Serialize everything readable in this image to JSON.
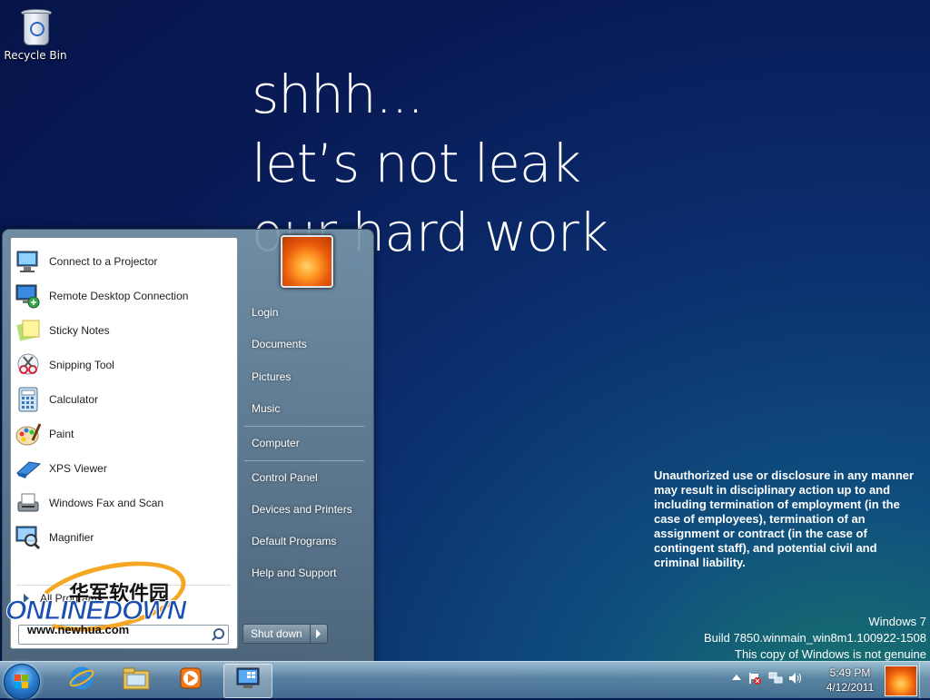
{
  "desktop": {
    "recycle_bin_label": "Recycle Bin",
    "wallpaper_lines": [
      "shhh...",
      "let’s not leak",
      "our hard work"
    ],
    "warning": "Unauthorized use or disclosure in any manner may result in disciplinary action up to and including termination of employment (in the case of employees), termination of an assignment or contract (in the case of contingent staff), and potential civil and criminal liability.",
    "watermark": {
      "line1": "Windows 7",
      "line2": "Build 7850.winmain_win8m1.100922-1508",
      "line3": "This copy of Windows is not genuine"
    }
  },
  "start_menu": {
    "programs": [
      {
        "label": "Connect to a Projector",
        "icon": "projector-icon"
      },
      {
        "label": "Remote Desktop Connection",
        "icon": "remote-desktop-icon"
      },
      {
        "label": "Sticky Notes",
        "icon": "sticky-notes-icon"
      },
      {
        "label": "Snipping Tool",
        "icon": "snipping-tool-icon"
      },
      {
        "label": "Calculator",
        "icon": "calculator-icon"
      },
      {
        "label": "Paint",
        "icon": "paint-icon"
      },
      {
        "label": "XPS Viewer",
        "icon": "xps-viewer-icon"
      },
      {
        "label": "Windows Fax and Scan",
        "icon": "fax-scan-icon"
      },
      {
        "label": "Magnifier",
        "icon": "magnifier-icon"
      }
    ],
    "all_programs": "All Programs",
    "right_items": {
      "login": "Login",
      "documents": "Documents",
      "pictures": "Pictures",
      "music": "Music",
      "computer": "Computer",
      "control_panel": "Control Panel",
      "devices_printers": "Devices and Printers",
      "default_programs": "Default Programs",
      "help_support": "Help and Support"
    },
    "shutdown_label": "Shut down"
  },
  "overlay_logo": {
    "chinese": "华军软件园",
    "brand": "ONLINEDOWN",
    "url": "www.newhua.com"
  },
  "taskbar": {
    "clock_time": "5:49 PM",
    "clock_date": "4/12/2011",
    "pinned": [
      "internet-explorer-icon",
      "explorer-folder-icon",
      "media-player-icon",
      "remote-desktop-icon"
    ]
  },
  "colors": {
    "accent": "#1e3287",
    "logo_orange": "#f5a623",
    "logo_blue": "#1a4fb0"
  }
}
